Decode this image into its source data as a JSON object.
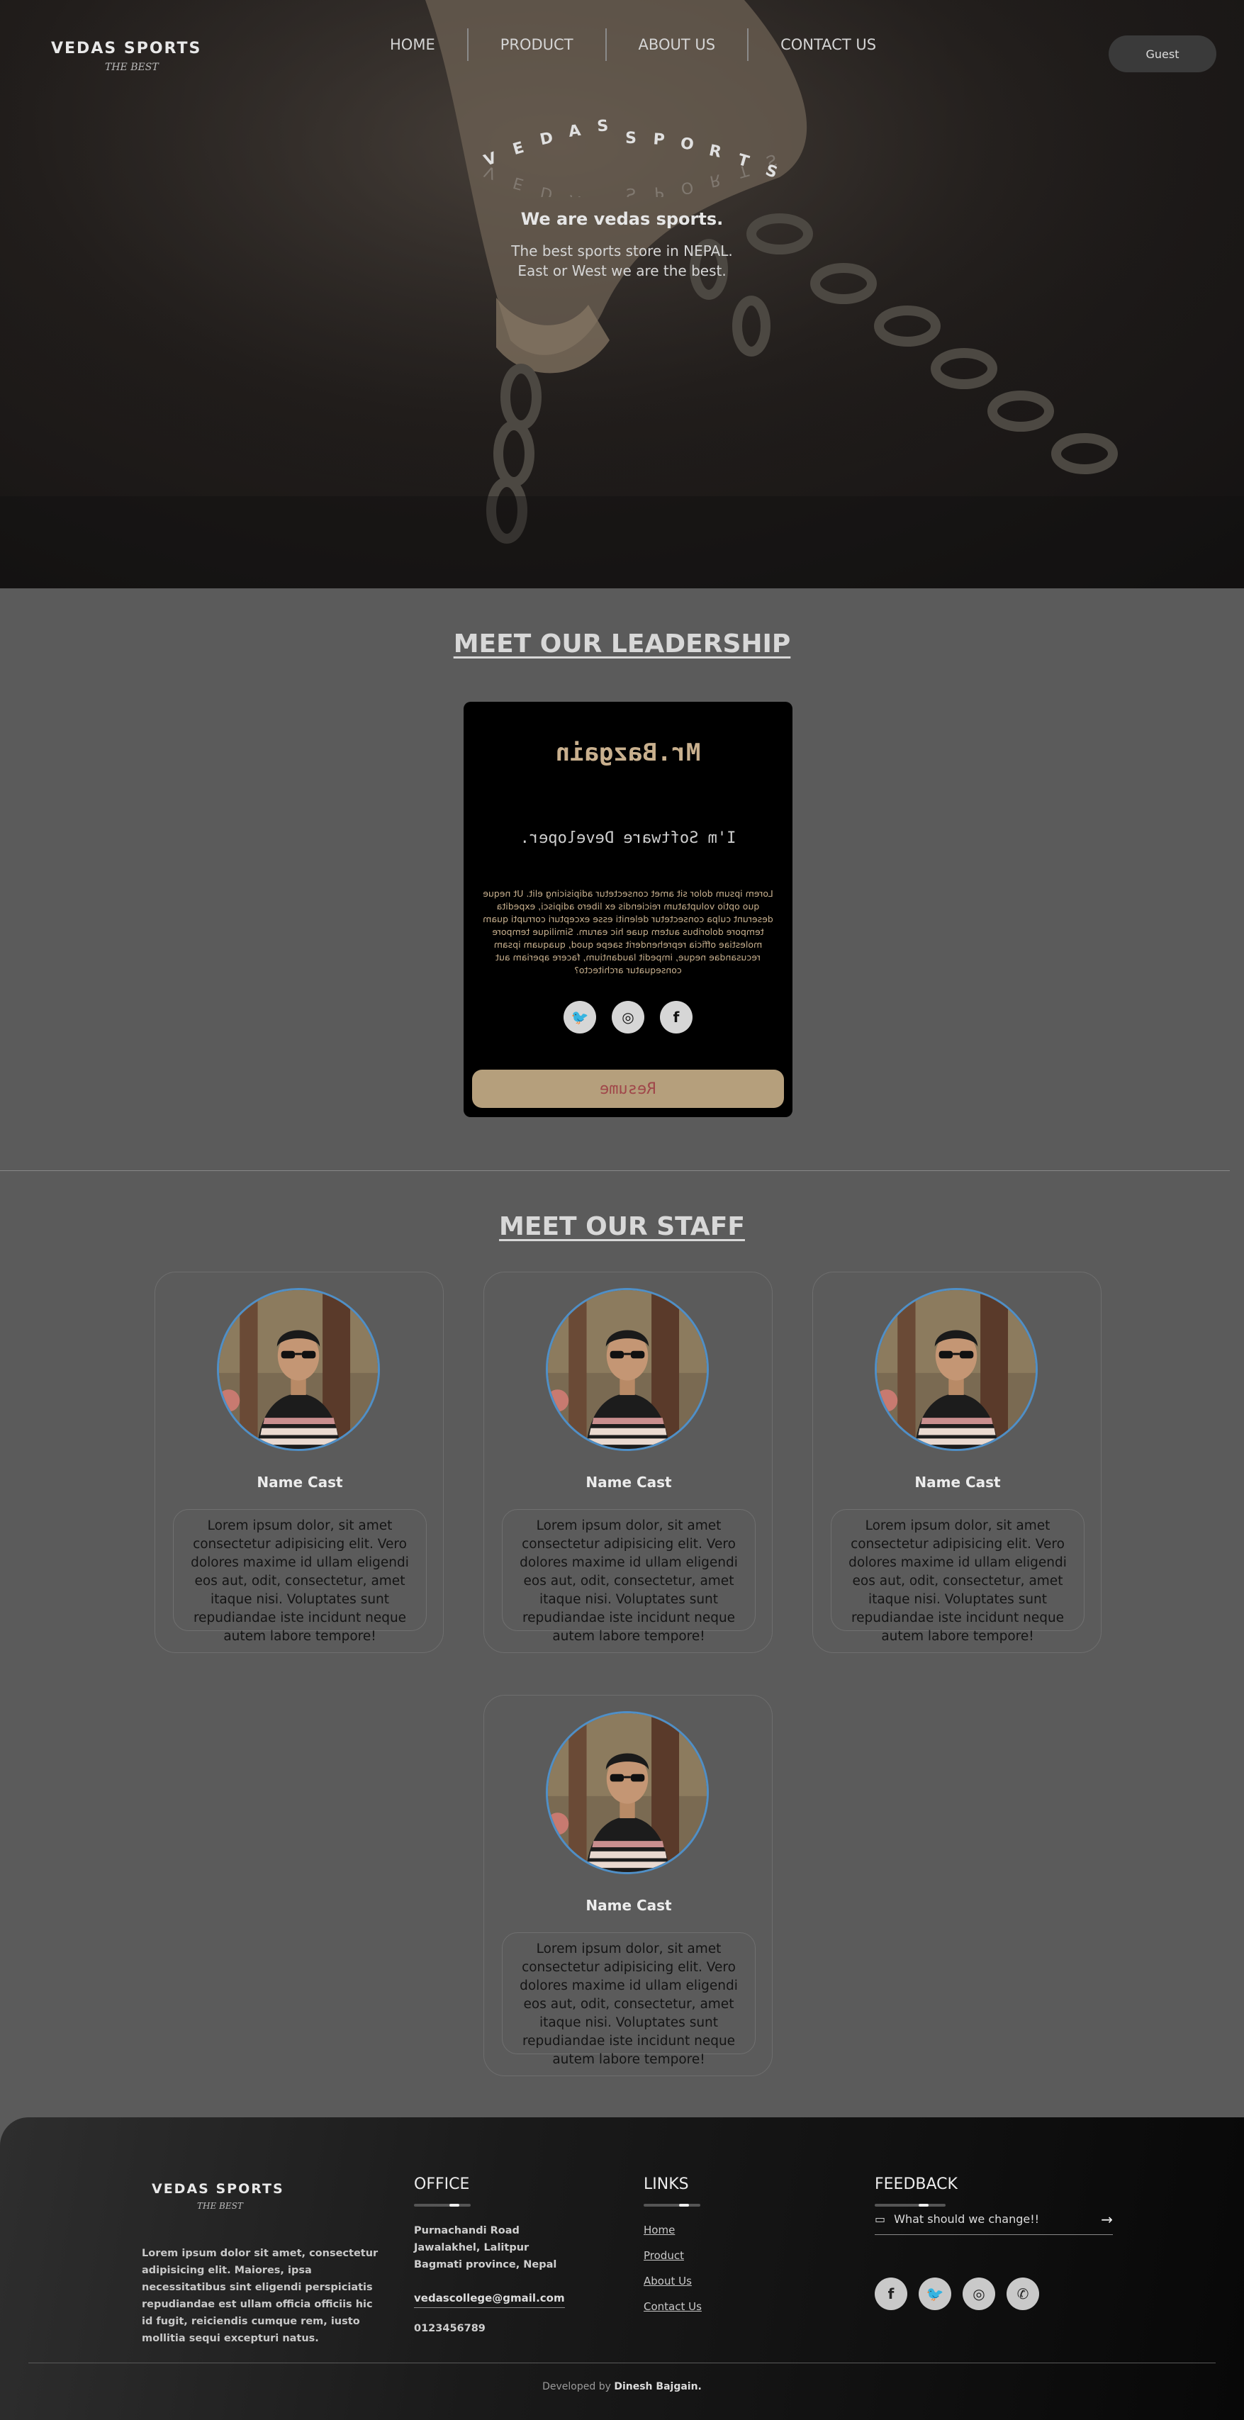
{
  "header": {
    "logo_text": "VEDAS SPORTS",
    "logo_tagline": "THE BEST",
    "nav": [
      "HOME",
      "PRODUCT",
      "ABOUT US",
      "CONTACT US"
    ],
    "guest_label": "Guest"
  },
  "hero": {
    "brand_letters": [
      "V",
      "E",
      "D",
      "A",
      "S",
      "S",
      "P",
      "O",
      "R",
      "T",
      "S"
    ],
    "headline": "We are vedas sports.",
    "line1": "The best sports store in NEPAL.",
    "line2": "East or West we are the best."
  },
  "leadership": {
    "title": "MEET OUR LEADERSHIP",
    "name": "Mr.Bazgain",
    "role": "I'm Software Developer.",
    "description": "Lorem ipsum dolor sit amet consectetur adipisicing elit. Ut neque quo optio voluptatum reiciendis ex libero adipisci, expedita deserunt culpa consectetur deleniti esse excepturi corrupti quam tempore doloribus autem quae hic earum. Similique tempore molestiae officia reprehenderit saepe quod, quaquam ipsam recusandae neque, impedit laudantium, facere aperiam aut consequatur architecto?",
    "social_icons": [
      "twitter-icon",
      "instagram-icon",
      "facebook-icon"
    ],
    "resume_label": "Resume"
  },
  "staff": {
    "title": "MEET OUR STAFF",
    "members": [
      {
        "name": "Name Cast",
        "bio": "Lorem ipsum dolor, sit amet consectetur adipisicing elit. Vero dolores maxime id ullam eligendi eos aut, odit, consectetur, amet itaque nisi. Voluptates sunt repudiandae iste incidunt neque autem labore tempore!"
      },
      {
        "name": "Name Cast",
        "bio": "Lorem ipsum dolor, sit amet consectetur adipisicing elit. Vero dolores maxime id ullam eligendi eos aut, odit, consectetur, amet itaque nisi. Voluptates sunt repudiandae iste incidunt neque autem labore tempore!"
      },
      {
        "name": "Name Cast",
        "bio": "Lorem ipsum dolor, sit amet consectetur adipisicing elit. Vero dolores maxime id ullam eligendi eos aut, odit, consectetur, amet itaque nisi. Voluptates sunt repudiandae iste incidunt neque autem labore tempore!"
      },
      {
        "name": "Name Cast",
        "bio": "Lorem ipsum dolor, sit amet consectetur adipisicing elit. Vero dolores maxime id ullam eligendi eos aut, odit, consectetur, amet itaque nisi. Voluptates sunt repudiandae iste incidunt neque autem labore tempore!"
      }
    ]
  },
  "footer": {
    "logo_text": "VEDAS SPORTS",
    "logo_tagline": "THE BEST",
    "about": "Lorem ipsum dolor sit amet, consectetur adipisicing elit. Maiores, ipsa necessitatibus sint eligendi perspiciatis repudiandae est ullam officia officiis hic id fugit, reiciendis cumque rem, iusto mollitia sequi excepturi natus.",
    "office_title": "OFFICE",
    "office_lines": [
      "Purnachandi Road",
      "Jawalakhel, Lalitpur",
      "Bagmati province, Nepal"
    ],
    "email": "vedascollege@gmail.com",
    "phone": "0123456789",
    "links_title": "LINKS",
    "links": [
      "Home",
      "Product",
      "About Us",
      "Contact Us"
    ],
    "feedback_title": "FEEDBACK",
    "feedback_placeholder": "What should we change!!",
    "social_icons": [
      "facebook-icon",
      "twitter-icon",
      "instagram-icon",
      "whatsapp-icon"
    ],
    "credit_prefix": "Developed by",
    "credit_name": "Dinesh Bajgain."
  },
  "colors": {
    "page_bg": "#5b5b5b",
    "card_bg": "#000000",
    "lead_accent": "#c9b08e",
    "resume_bg": "#b59f7c",
    "avatar_ring": "#4f8fc7"
  }
}
